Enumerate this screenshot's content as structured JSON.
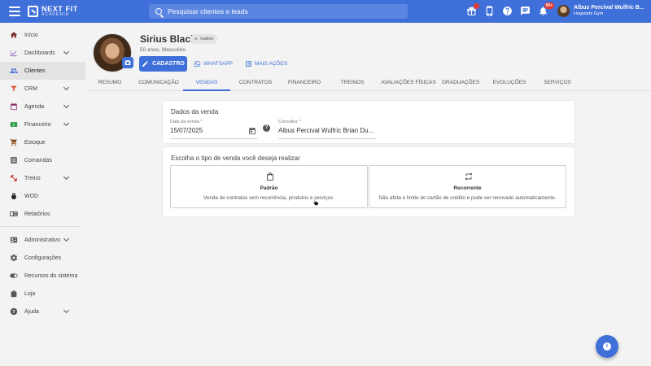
{
  "app": {
    "logo_main": "NEXT FIT",
    "logo_sub": "ACADEMIA"
  },
  "search": {
    "placeholder": "Pesquisar clientes e leads"
  },
  "top_icons": [
    "gift-icon",
    "phone-icon",
    "help-icon",
    "chat-icon",
    "bell-icon"
  ],
  "notifications_badge": "99+",
  "user": {
    "name": "Albus Percival Wulfric B...",
    "gym": "Hogwarts Gym"
  },
  "sidebar": {
    "items": [
      {
        "label": "Início",
        "icon": "home-icon",
        "expandable": false
      },
      {
        "label": "Dashboards",
        "icon": "chart-icon",
        "expandable": true
      },
      {
        "label": "Clientes",
        "icon": "users-icon",
        "expandable": false,
        "active": true
      },
      {
        "label": "CRM",
        "icon": "crm-icon",
        "expandable": true
      },
      {
        "label": "Agenda",
        "icon": "calendar-icon",
        "expandable": true
      },
      {
        "label": "Financeiro",
        "icon": "money-icon",
        "expandable": true
      },
      {
        "label": "Estoque",
        "icon": "cart-icon",
        "expandable": false
      },
      {
        "label": "Comandas",
        "icon": "receipt-icon",
        "expandable": false
      },
      {
        "label": "Treino",
        "icon": "dumbbell-icon",
        "expandable": true
      },
      {
        "label": "WOD",
        "icon": "kettlebell-icon",
        "expandable": false
      },
      {
        "label": "Relatórios",
        "icon": "report-icon",
        "expandable": false
      },
      {
        "label": "Administrativo",
        "icon": "admin-icon",
        "expandable": true
      },
      {
        "label": "Configurações",
        "icon": "gear-icon",
        "expandable": false
      },
      {
        "label": "Recursos do sistema",
        "icon": "toggle-icon",
        "expandable": false
      },
      {
        "label": "Loja",
        "icon": "shop-icon",
        "expandable": false
      },
      {
        "label": "Ajuda",
        "icon": "help-circle-icon",
        "expandable": true
      }
    ]
  },
  "profile": {
    "name": "Sirius Black",
    "status": "Inativo",
    "info": "50 anos, Masculino",
    "cadastro_label": "CADASTRO",
    "whatsapp_label": "WHATSAPP",
    "mais_acoes_label": "MAIS AÇÕES"
  },
  "tabs": [
    {
      "label": "RESUMO",
      "active": false
    },
    {
      "label": "COMUNICAÇÃO",
      "active": false
    },
    {
      "label": "VENDAS",
      "active": true
    },
    {
      "label": "CONTRATOS",
      "active": false
    },
    {
      "label": "FINANCEIRO",
      "active": false
    },
    {
      "label": "TREINOS",
      "active": false
    },
    {
      "label": "AVALIAÇÕES FÍSICAS",
      "active": false
    },
    {
      "label": "GRADUAÇÕES",
      "active": false
    },
    {
      "label": "EVOLUÇÕES",
      "active": false
    },
    {
      "label": "SERVIÇOS",
      "active": false
    }
  ],
  "sale": {
    "title": "Dados da venda",
    "date_label": "Data da venda *",
    "date_value": "15/07/2025",
    "consultant_label": "Consultor *",
    "consultant_value": "Albus Percival Wulfric Brian Du..."
  },
  "sale_type": {
    "title": "Escolha o tipo de venda você deseja realizar",
    "options": [
      {
        "title": "Padrão",
        "desc": "Venda de contratos sem recorrência, produtos e serviços.",
        "icon": "shopping-bag-icon"
      },
      {
        "title": "Recorrente",
        "desc": "Não afeta o limite do cartão de crédito e pode ser renovado automaticamente.",
        "icon": "repeat-icon"
      }
    ]
  },
  "colors": {
    "primary": "#3f6fd8",
    "badge": "#e53935",
    "background": "#f3f3f3"
  }
}
